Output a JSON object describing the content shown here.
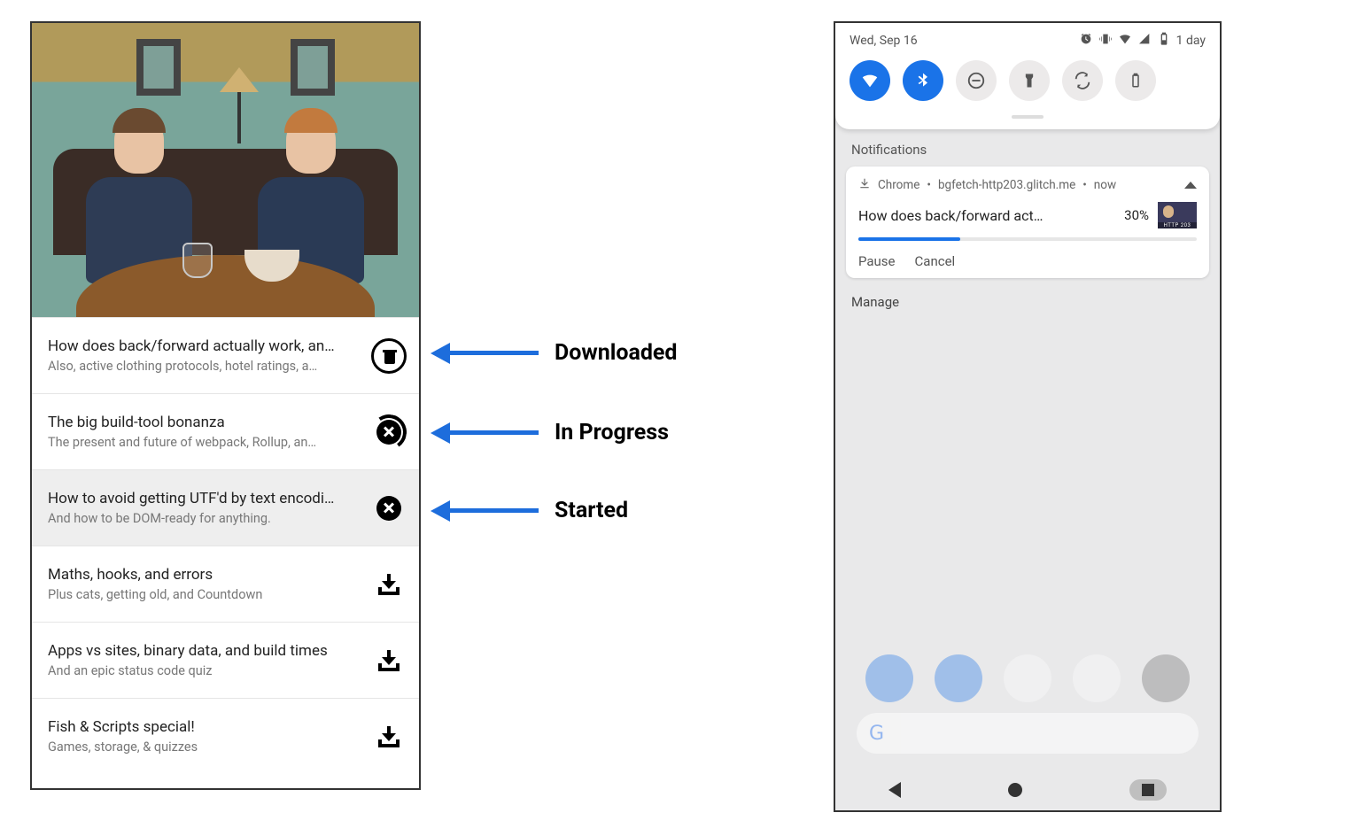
{
  "annotations": {
    "downloaded": "Downloaded",
    "in_progress": "In Progress",
    "started": "Started"
  },
  "podcast": {
    "episodes": [
      {
        "title": "How does back/forward actually work, an…",
        "subtitle": "Also, active clothing protocols, hotel ratings, a…",
        "state": "downloaded"
      },
      {
        "title": "The big build-tool bonanza",
        "subtitle": "The present and future of webpack, Rollup, an…",
        "state": "in_progress"
      },
      {
        "title": "How to avoid getting UTF'd by text encodi…",
        "subtitle": "And how to be DOM-ready for anything.",
        "state": "started",
        "selected": true
      },
      {
        "title": "Maths, hooks, and errors",
        "subtitle": "Plus cats, getting old, and Countdown",
        "state": "not_started"
      },
      {
        "title": "Apps vs sites, binary data, and build times",
        "subtitle": "And an epic status code quiz",
        "state": "not_started"
      },
      {
        "title": "Fish & Scripts special!",
        "subtitle": "Games, storage, & quizzes",
        "state": "not_started"
      }
    ]
  },
  "android": {
    "status": {
      "date": "Wed, Sep 16",
      "battery_label": "1 day"
    },
    "quick_settings": [
      {
        "name": "wifi",
        "active": true
      },
      {
        "name": "bluetooth",
        "active": true
      },
      {
        "name": "dnd",
        "active": false
      },
      {
        "name": "flashlight",
        "active": false
      },
      {
        "name": "autorotate",
        "active": false
      },
      {
        "name": "battery-saver",
        "active": false
      }
    ],
    "notifications_label": "Notifications",
    "notification": {
      "app": "Chrome",
      "source": "bgfetch-http203.glitch.me",
      "when": "now",
      "title": "How does back/forward act…",
      "progress_pct": 30,
      "progress_label": "30%",
      "actions": {
        "pause": "Pause",
        "cancel": "Cancel"
      }
    },
    "manage_label": "Manage"
  }
}
